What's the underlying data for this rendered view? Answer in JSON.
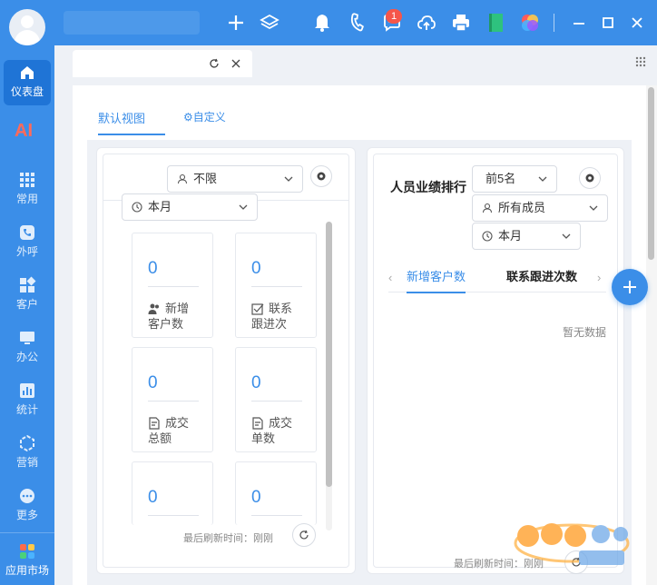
{
  "sidebar": {
    "items": [
      {
        "label": "仪表盘",
        "icon": "home-icon"
      },
      {
        "label": "常用",
        "icon": "grid-icon"
      },
      {
        "label": "外呼",
        "icon": "phone-icon"
      },
      {
        "label": "客户",
        "icon": "apps-icon"
      },
      {
        "label": "办公",
        "icon": "monitor-icon"
      },
      {
        "label": "统计",
        "icon": "bar-chart-icon"
      },
      {
        "label": "营销",
        "icon": "hexagon-icon"
      },
      {
        "label": "更多",
        "icon": "more-icon"
      }
    ],
    "ai_label": "AI",
    "market_label": "应用市场"
  },
  "topbar": {
    "notification_count": "1"
  },
  "view_tabs": {
    "default": "默认视图",
    "custom": "自定义"
  },
  "left_panel": {
    "user_filter": "不限",
    "period_filter": "本月",
    "stats": [
      {
        "value": "0",
        "label": "新增客户数",
        "icon": "users-icon"
      },
      {
        "value": "0",
        "label": "联系跟进次",
        "icon": "checkbox-icon"
      },
      {
        "value": "0",
        "label": "成交总额",
        "icon": "document-icon"
      },
      {
        "value": "0",
        "label": "成交单数",
        "icon": "document-icon"
      },
      {
        "value": "0",
        "label": "",
        "icon": ""
      },
      {
        "value": "0",
        "label": "",
        "icon": ""
      }
    ],
    "refresh_text": "最后刷新时间：刚刚"
  },
  "right_panel": {
    "title": "人员业绩排行",
    "top_filter": "前5名",
    "member_filter": "所有成员",
    "period_filter": "本月",
    "tabs": [
      "新增客户数",
      "联系跟进次数"
    ],
    "empty_text": "暂无数据",
    "refresh_text": "最后刷新时间：刚刚"
  },
  "colors": {
    "primary": "#3b8ee8",
    "sidebar_active": "#1f74d6",
    "badge": "#f5564a"
  }
}
